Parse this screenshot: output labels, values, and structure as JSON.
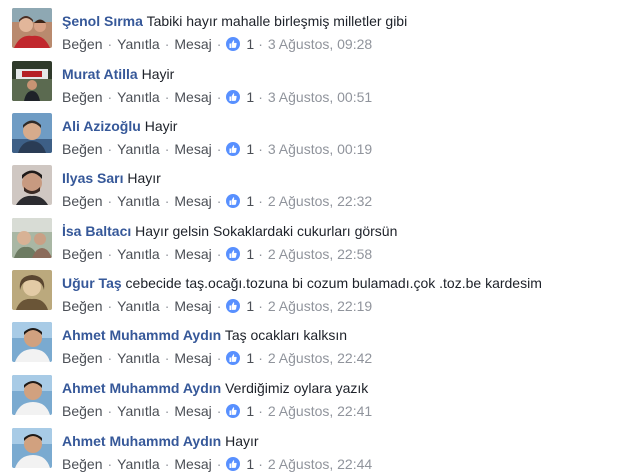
{
  "actions": {
    "like": "Beğen",
    "reply": "Yanıtla",
    "message": "Mesaj"
  },
  "colors": {
    "author": "#365899",
    "like_badge": "#5890ff",
    "meta": "#90949c"
  },
  "comments": [
    {
      "author": "Şenol Sırma",
      "text": "Tabiki hayır mahalle birleşmiş milletler gibi",
      "likes": "1",
      "time": "3 Ağustos, 09:28"
    },
    {
      "author": "Murat Atilla",
      "text": "Hayir",
      "likes": "1",
      "time": "3 Ağustos, 00:51"
    },
    {
      "author": "Ali Azizoğlu",
      "text": "Hayir",
      "likes": "1",
      "time": "3 Ağustos, 00:19"
    },
    {
      "author": "Ilyas Sarı",
      "text": "Hayır",
      "likes": "1",
      "time": "2 Ağustos, 22:32"
    },
    {
      "author": "İsa Baltacı",
      "text": "Hayır gelsin Sokaklardaki cukurları görsün",
      "likes": "1",
      "time": "2 Ağustos, 22:58"
    },
    {
      "author": "Uğur Taş",
      "text": "cebecide taş.ocağı.tozuna bi cozum bulamadı.çok .toz.be kardesim",
      "likes": "1",
      "time": "2 Ağustos, 22:19"
    },
    {
      "author": "Ahmet Muhammd Aydın",
      "text": "Taş ocakları kalksın",
      "likes": "1",
      "time": "2 Ağustos, 22:42"
    },
    {
      "author": "Ahmet Muhammd Aydın",
      "text": "Verdiğimiz oylara yazık",
      "likes": "1",
      "time": "2 Ağustos, 22:41"
    },
    {
      "author": "Ahmet Muhammd Aydın",
      "text": "Hayır",
      "likes": "1",
      "time": "2 Ağustos, 22:44"
    }
  ]
}
